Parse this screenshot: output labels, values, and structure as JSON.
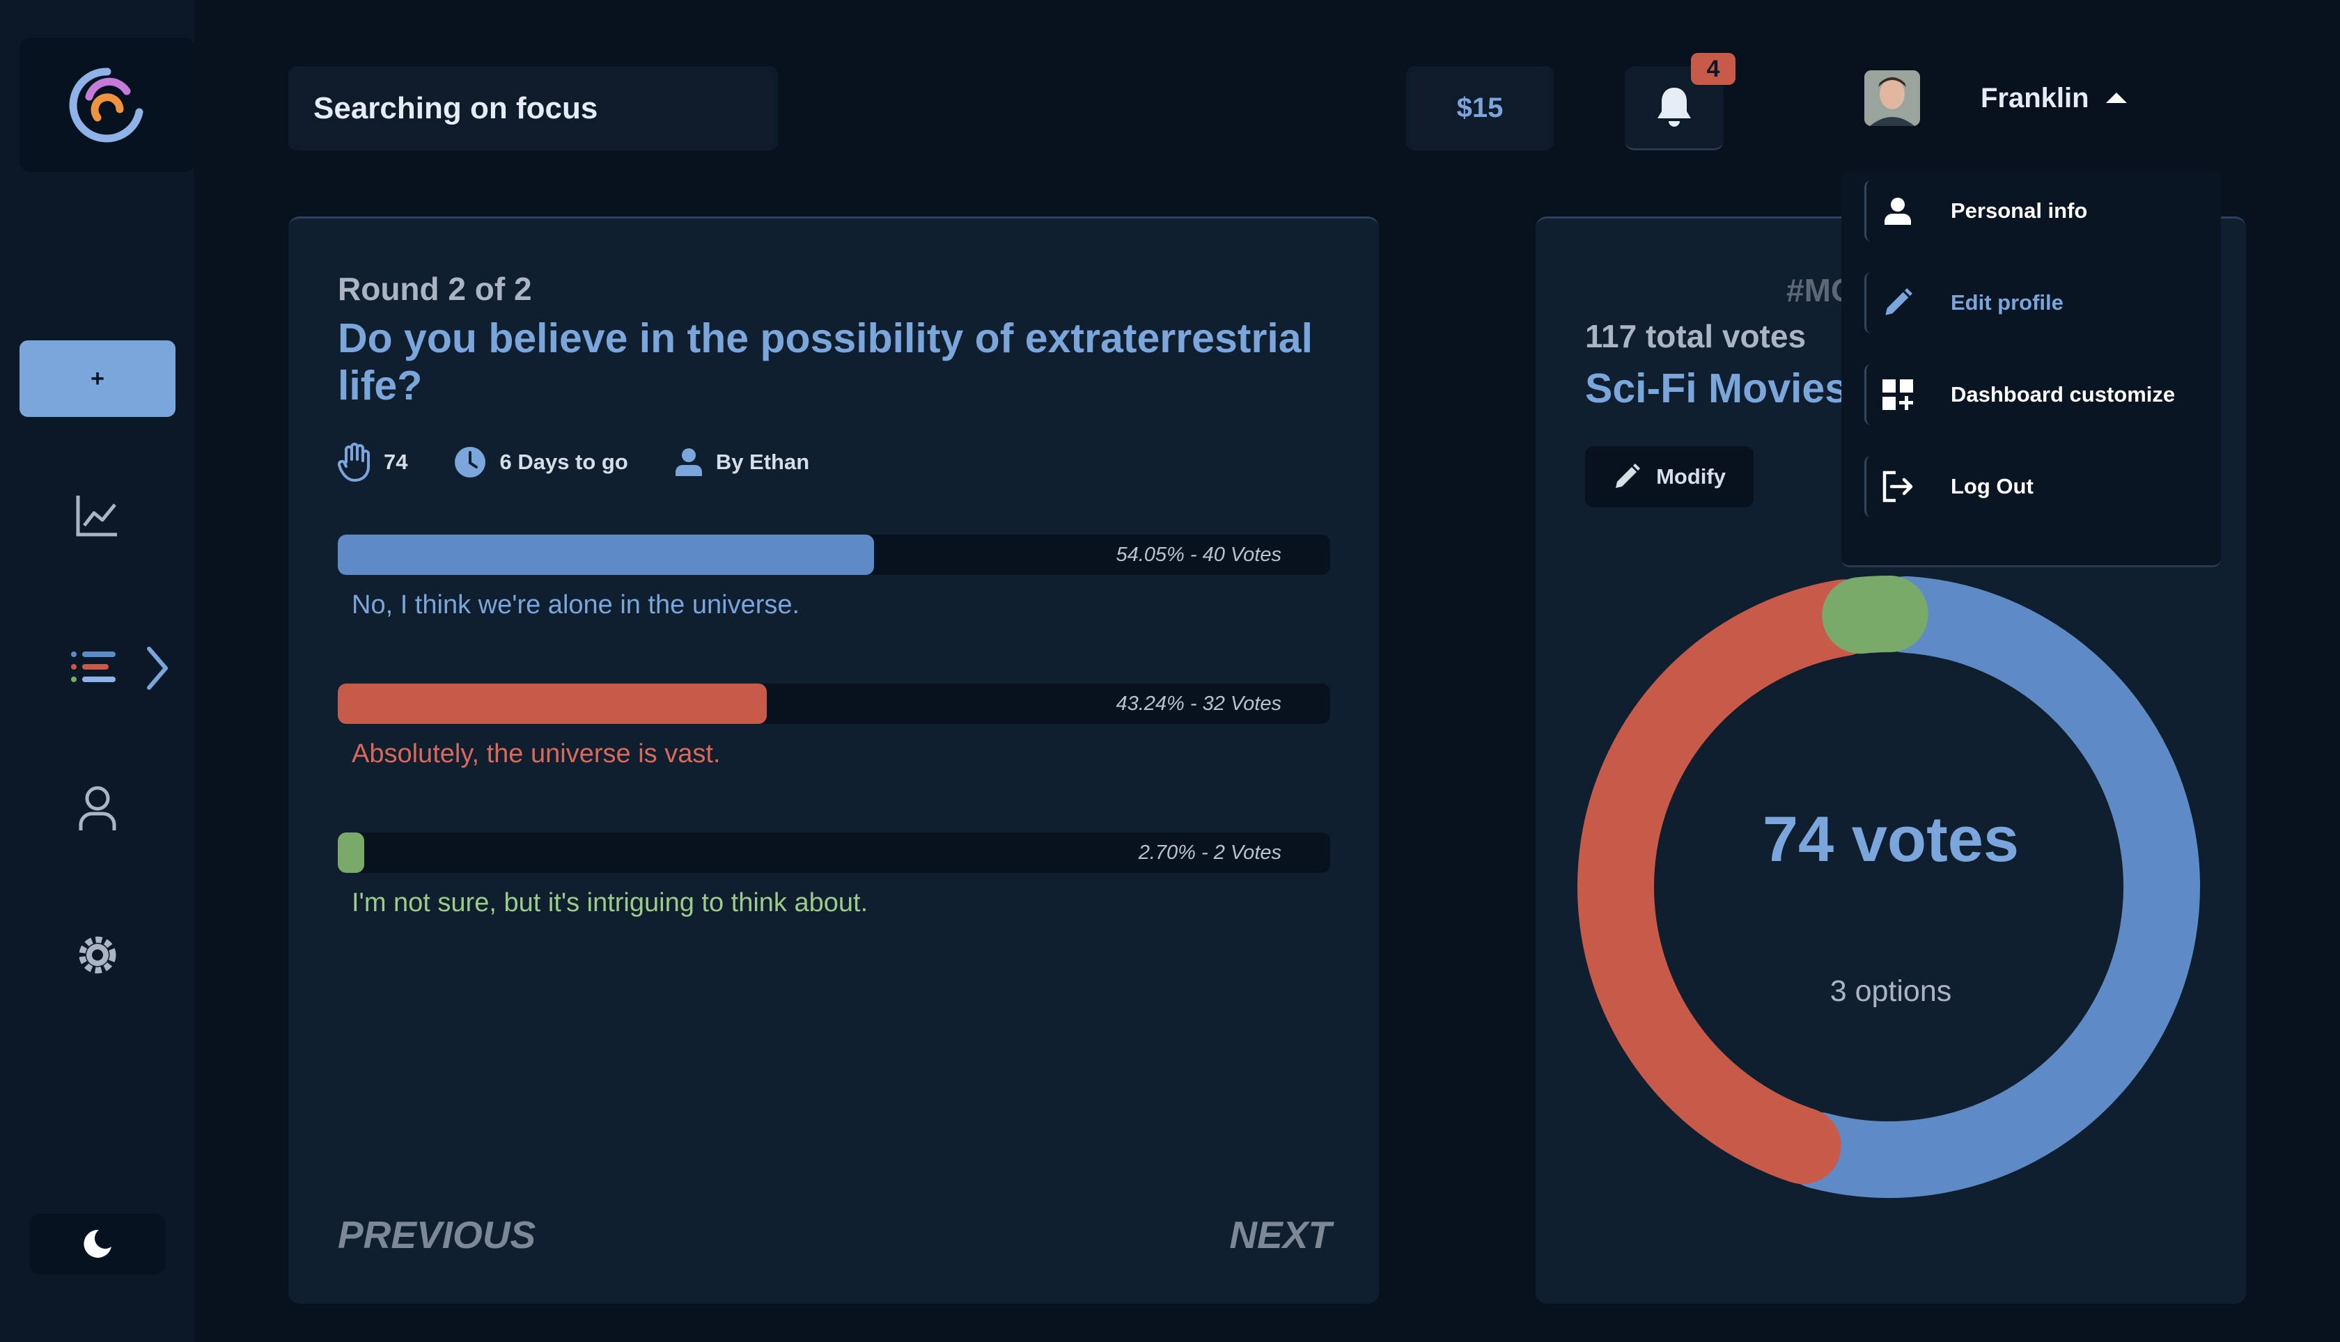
{
  "header": {
    "search_text": "Searching on focus",
    "balance": "$15",
    "notification_count": "4",
    "user_name": "Franklin"
  },
  "sidebar": {
    "add_label": "+",
    "icons": [
      "chart-icon",
      "list-icon",
      "user-icon",
      "settings-icon"
    ]
  },
  "poll": {
    "round": "Round 2 of 2",
    "question": "Do you believe in the possibility of extraterrestrial life?",
    "votes_count": "74",
    "time_left": "6 Days to go",
    "author": "By Ethan",
    "options": [
      {
        "text": "No, I think we're alone in the universe.",
        "stat": "54.05% - 40 Votes",
        "percent": 54.05,
        "color": "#5e8bc6",
        "label_color": "#7ba6dc"
      },
      {
        "text": "Absolutely, the universe is vast.",
        "stat": "43.24% - 32 Votes",
        "percent": 43.24,
        "color": "#c85a4a",
        "label_color": "#d9695a"
      },
      {
        "text": "I'm not sure, but it's intriguing to think about.",
        "stat": "2.70% - 2 Votes",
        "percent": 2.7,
        "color": "#7aaa6a",
        "label_color": "#9ccc88"
      }
    ],
    "prev": "PREVIOUS",
    "next": "NEXT"
  },
  "summary": {
    "tag": "#MO",
    "total_votes": "117 total votes",
    "title": "Sci-Fi Movies",
    "modify": "Modify",
    "center_votes": "74 votes",
    "center_options": "3 options"
  },
  "menu": {
    "items": [
      {
        "label": "Personal info",
        "icon": "person-icon",
        "color": "#ffffff"
      },
      {
        "label": "Edit profile",
        "icon": "pencil-icon",
        "color": "#7ba6dc"
      },
      {
        "label": "Dashboard customize",
        "icon": "dashboard-icon",
        "color": "#ffffff"
      },
      {
        "label": "Log Out",
        "icon": "logout-icon",
        "color": "#ffffff"
      }
    ]
  },
  "colors": {
    "accent": "#7ba6dc",
    "blue": "#5e8bc6",
    "red": "#c85a4a",
    "green": "#7aaa6a"
  }
}
